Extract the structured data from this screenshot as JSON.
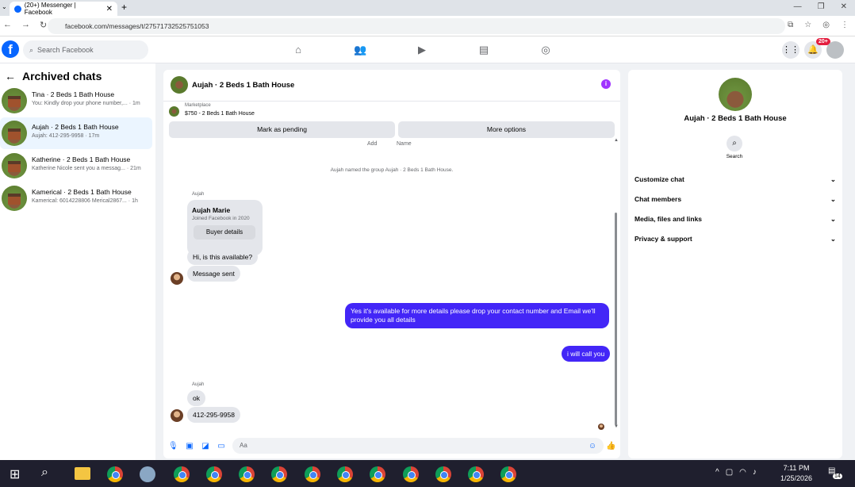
{
  "browser": {
    "tab_title": "(20+) Messenger | Facebook",
    "tab_close": "✕",
    "new_tab": "+",
    "url": "facebook.com/messages/t/27571732525751053",
    "window_controls": [
      "—",
      "❐",
      "✕"
    ]
  },
  "fb": {
    "logo": "f",
    "search_placeholder": "Search Facebook",
    "notification_badge": "20+"
  },
  "left": {
    "title": "Archived chats",
    "back_icon": "←",
    "chats": [
      {
        "name": "Tina · 2 Beds 1 Bath House",
        "preview": "You: Kindly drop your phone number,... · 1m"
      },
      {
        "name": "Aujah · 2 Beds 1 Bath House",
        "preview": "Aujah: 412-295-9958 · 17m"
      },
      {
        "name": "Katherine · 2 Beds 1 Bath House",
        "preview": "Katherine Nicole sent you a messag... · 21m"
      },
      {
        "name": "Kamerical · 2 Beds 1 Bath House",
        "preview": "Kamerical: 6014228806 Merical2867... · 1h"
      }
    ]
  },
  "conversation": {
    "title": "Aujah · 2 Beds 1 Bath House",
    "info_icon": "i",
    "marketplace_label": "Marketplace",
    "listing": "$750 - 2 Beds 1 Bath House",
    "mark_pending": "Mark as pending",
    "more_options": "More options",
    "top_cut_add": "Add",
    "top_cut_name": "Name",
    "system_message": "Aujah named the group Aujah · 2 Beds 1 Bath House.",
    "sender1": "Aujah",
    "card_name": "Aujah Marie",
    "card_sub": "Joined Facebook in 2020",
    "card_button": "Buyer details",
    "msg_available": "Hi, is this available?",
    "msg_sent": "Message sent",
    "my_msg1": "Yes it's available for more details please drop your contact number and Email we'll provide you all details",
    "my_msg2": "i will call you",
    "sender2": "Aujah",
    "msg_ok": "ok",
    "msg_phone": "412-295-9958",
    "composer_placeholder": "Aa"
  },
  "right": {
    "title": "Aujah · 2 Beds 1 Bath House",
    "search_label": "Search",
    "sections": [
      "Customize chat",
      "Chat members",
      "Media, files and links",
      "Privacy & support"
    ]
  },
  "taskbar": {
    "time": "7:11 PM",
    "date": "1/25/2026",
    "notif_count": "14"
  },
  "colors": {
    "fb_blue": "#0866ff",
    "my_bubble": "#4326f7",
    "info_purple": "#a033ff"
  }
}
